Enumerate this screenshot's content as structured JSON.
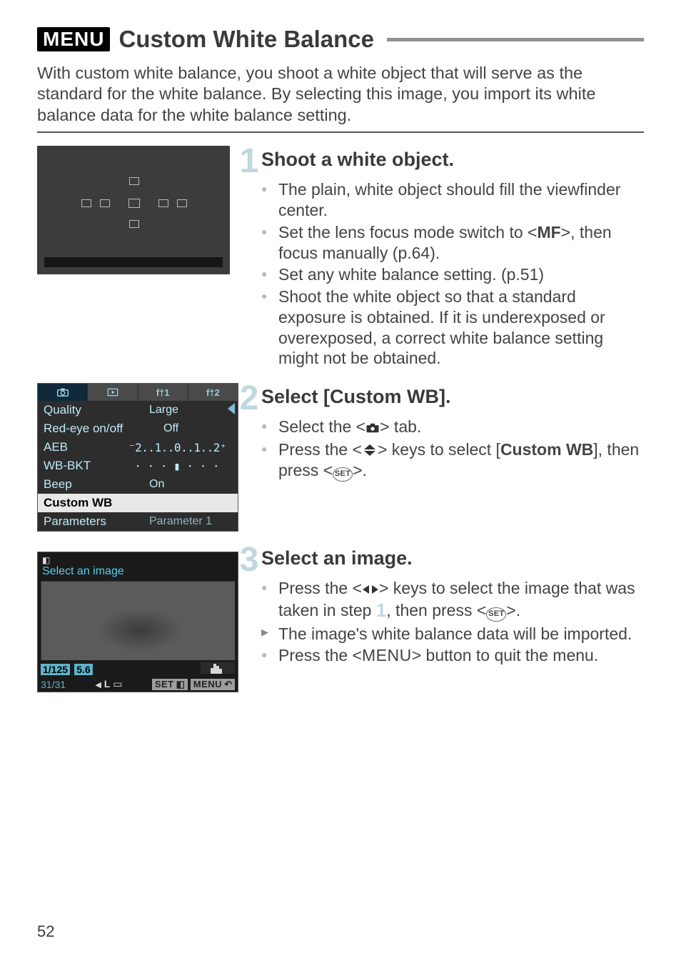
{
  "title": {
    "badge": "MENU",
    "text": "Custom White Balance"
  },
  "intro": "With custom white balance, you shoot a white object that will serve as the standard for the white balance. By selecting this image, you import its white balance data for the white balance setting.",
  "steps": {
    "s1": {
      "num": "1",
      "title": "Shoot a white object.",
      "b1": "The plain, white object should fill the viewfinder center.",
      "b2a": "Set the lens focus mode switch to <",
      "b2mf": "MF",
      "b2b": ">, then focus manually (p.64).",
      "b3": "Set any white balance setting. (p.51)",
      "b4": "Shoot the white object so that a standard exposure is obtained. If it is underexposed or overexposed, a correct white balance setting might not be obtained."
    },
    "s2": {
      "num": "2",
      "title": "Select [Custom WB].",
      "b1a": "Select the <",
      "b1b": "> tab.",
      "b2a": "Press the <",
      "b2b": "> keys to select [",
      "b2c": "Custom WB",
      "b2d": "], then press <",
      "b2e": ">."
    },
    "s3": {
      "num": "3",
      "title": "Select an image.",
      "b1a": "Press the <",
      "b1b": "> keys to select the image that was taken in step ",
      "b1num": "1",
      "b1c": ", then press <",
      "b1d": ">.",
      "b2": "The image's white balance data will be imported.",
      "b3a": "Press the <",
      "b3menu": "MENU",
      "b3b": "> button to quit the menu."
    }
  },
  "menu_shot": {
    "tabs": {
      "t1": "",
      "t2": "",
      "t3": "",
      "t4": ""
    },
    "rows": {
      "quality_l": "Quality",
      "quality_v": "Large",
      "redeye_l": "Red-eye on/off",
      "redeye_v": "Off",
      "aeb_l": "AEB",
      "aeb_v": "⁻2..1..0..1..2⁺",
      "wb_l": "WB-BKT",
      "wb_v": "· · · ▮ · · ·",
      "beep_l": "Beep",
      "beep_v": "On",
      "custom_l": "Custom WB",
      "param_l": "Parameters",
      "param_v": "Parameter 1"
    }
  },
  "img_shot": {
    "header_icon": "▣",
    "select_line": "Select an image",
    "shutter": "1/125",
    "fnum": "5.6",
    "count": "31/31",
    "size_badge": "L",
    "set_badge": "SET",
    "menu_badge": "MENU"
  },
  "pagenum": "52"
}
